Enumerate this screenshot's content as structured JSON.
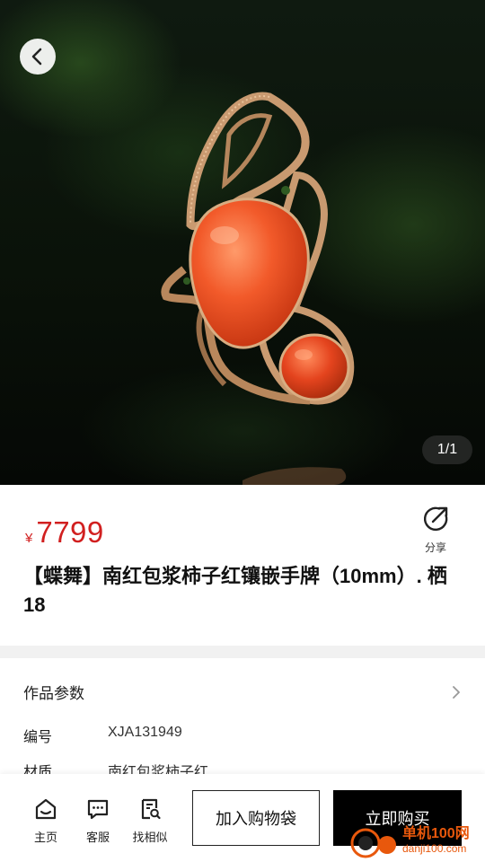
{
  "hero": {
    "image_counter": "1/1",
    "back_icon": "chevron-left-icon"
  },
  "product": {
    "currency": "¥",
    "price": "7799",
    "title": "【蝶舞】南红包浆柿子红镶嵌手牌（10mm）. 栖18",
    "share_label": "分享"
  },
  "params": {
    "section_title": "作品参数",
    "rows": [
      {
        "key": "编号",
        "value": "XJA131949"
      },
      {
        "key": "材质",
        "value": "南红包浆柿子红"
      }
    ]
  },
  "bottom_bar": {
    "nav": [
      {
        "label": "主页",
        "icon": "home-icon"
      },
      {
        "label": "客服",
        "icon": "chat-icon"
      },
      {
        "label": "找相似",
        "icon": "find-similar-icon"
      }
    ],
    "add_to_cart": "加入购物袋",
    "buy_now": "立即购买"
  },
  "watermark": {
    "name": "单机100网",
    "domain": "danji100.com"
  },
  "colors": {
    "price_red": "#d11f1f",
    "buy_button_bg": "#000000",
    "watermark_orange": "#e8580c"
  }
}
